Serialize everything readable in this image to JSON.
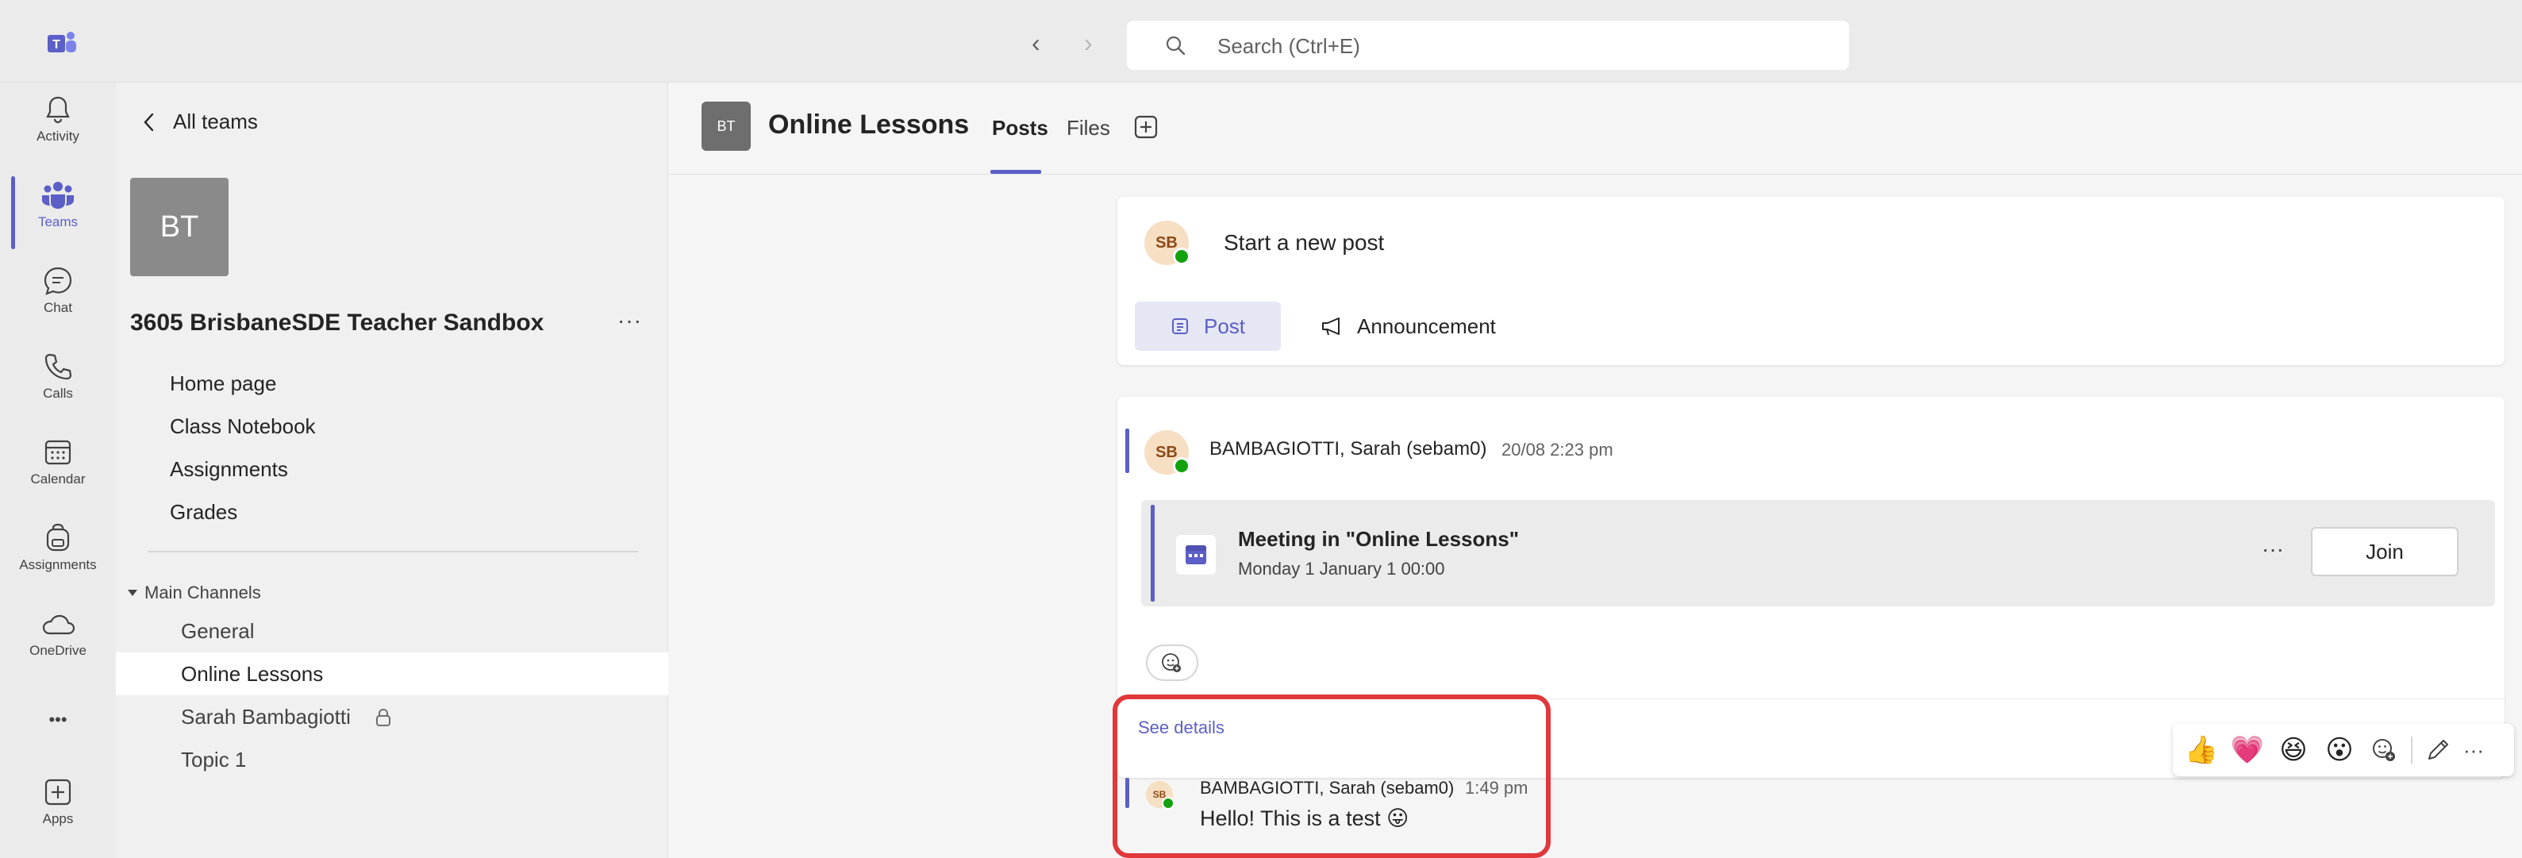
{
  "topbar": {
    "back_glyph": "‹",
    "forward_glyph": "›",
    "search_placeholder": "Search (Ctrl+E)"
  },
  "rail": {
    "activity": "Activity",
    "teams": "Teams",
    "chat": "Chat",
    "calls": "Calls",
    "calendar": "Calendar",
    "assignments": "Assignments",
    "onedrive": "OneDrive",
    "more": "•••",
    "apps": "Apps"
  },
  "sidebar": {
    "all_teams": "All teams",
    "team_initials": "BT",
    "team_name": "3605 BrisbaneSDE Teacher Sandbox",
    "team_more": "···",
    "links": [
      "Home page",
      "Class Notebook",
      "Assignments",
      "Grades"
    ],
    "channels_heading": "Main Channels",
    "channels": [
      "General",
      "Online Lessons",
      "Sarah Bambagiotti",
      "Topic 1"
    ]
  },
  "channel": {
    "avatar": "BT",
    "title": "Online Lessons",
    "tabs": {
      "posts": "Posts",
      "files": "Files"
    }
  },
  "new_post": {
    "avatar": "SB",
    "prompt": "Start a new post",
    "post_label": "Post",
    "announcement_label": "Announcement"
  },
  "thread": {
    "avatar": "SB",
    "author": "BAMBAGIOTTI, Sarah (sebam0)",
    "time": "20/08 2:23 pm",
    "meeting_title": "Meeting in \"Online Lessons\"",
    "meeting_time": "Monday 1 January 1 00:00",
    "meeting_more": "···",
    "join_label": "Join"
  },
  "reply": {
    "see_details": "See details",
    "avatar": "SB",
    "author": "BAMBAGIOTTI, Sarah (sebam0)",
    "time": "1:49 pm",
    "text": "Hello! This is a test 😛"
  },
  "reactions": {
    "like": "👍",
    "heart": "💗",
    "laugh": "😆",
    "surprised": "😮",
    "more": "···"
  },
  "colors": {
    "brand": "#5b5fc7",
    "highlight": "#e0383b",
    "presence": "#13a10e"
  }
}
